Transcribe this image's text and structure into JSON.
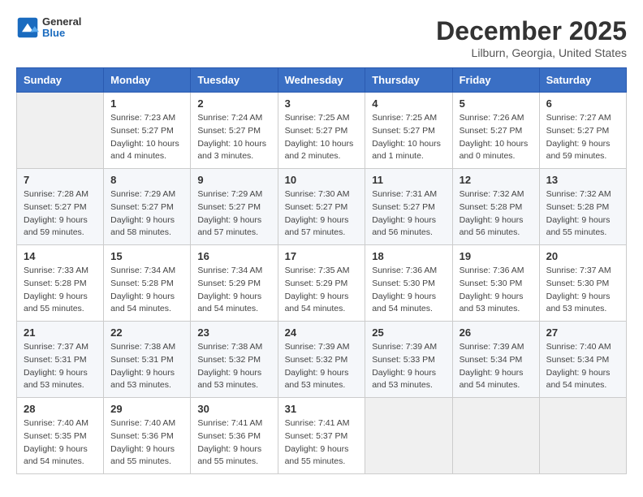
{
  "header": {
    "logo_general": "General",
    "logo_blue": "Blue",
    "month_title": "December 2025",
    "location": "Lilburn, Georgia, United States"
  },
  "weekdays": [
    "Sunday",
    "Monday",
    "Tuesday",
    "Wednesday",
    "Thursday",
    "Friday",
    "Saturday"
  ],
  "weeks": [
    [
      {
        "day": "",
        "info": ""
      },
      {
        "day": "1",
        "info": "Sunrise: 7:23 AM\nSunset: 5:27 PM\nDaylight: 10 hours\nand 4 minutes."
      },
      {
        "day": "2",
        "info": "Sunrise: 7:24 AM\nSunset: 5:27 PM\nDaylight: 10 hours\nand 3 minutes."
      },
      {
        "day": "3",
        "info": "Sunrise: 7:25 AM\nSunset: 5:27 PM\nDaylight: 10 hours\nand 2 minutes."
      },
      {
        "day": "4",
        "info": "Sunrise: 7:25 AM\nSunset: 5:27 PM\nDaylight: 10 hours\nand 1 minute."
      },
      {
        "day": "5",
        "info": "Sunrise: 7:26 AM\nSunset: 5:27 PM\nDaylight: 10 hours\nand 0 minutes."
      },
      {
        "day": "6",
        "info": "Sunrise: 7:27 AM\nSunset: 5:27 PM\nDaylight: 9 hours\nand 59 minutes."
      }
    ],
    [
      {
        "day": "7",
        "info": "Sunrise: 7:28 AM\nSunset: 5:27 PM\nDaylight: 9 hours\nand 59 minutes."
      },
      {
        "day": "8",
        "info": "Sunrise: 7:29 AM\nSunset: 5:27 PM\nDaylight: 9 hours\nand 58 minutes."
      },
      {
        "day": "9",
        "info": "Sunrise: 7:29 AM\nSunset: 5:27 PM\nDaylight: 9 hours\nand 57 minutes."
      },
      {
        "day": "10",
        "info": "Sunrise: 7:30 AM\nSunset: 5:27 PM\nDaylight: 9 hours\nand 57 minutes."
      },
      {
        "day": "11",
        "info": "Sunrise: 7:31 AM\nSunset: 5:27 PM\nDaylight: 9 hours\nand 56 minutes."
      },
      {
        "day": "12",
        "info": "Sunrise: 7:32 AM\nSunset: 5:28 PM\nDaylight: 9 hours\nand 56 minutes."
      },
      {
        "day": "13",
        "info": "Sunrise: 7:32 AM\nSunset: 5:28 PM\nDaylight: 9 hours\nand 55 minutes."
      }
    ],
    [
      {
        "day": "14",
        "info": "Sunrise: 7:33 AM\nSunset: 5:28 PM\nDaylight: 9 hours\nand 55 minutes."
      },
      {
        "day": "15",
        "info": "Sunrise: 7:34 AM\nSunset: 5:28 PM\nDaylight: 9 hours\nand 54 minutes."
      },
      {
        "day": "16",
        "info": "Sunrise: 7:34 AM\nSunset: 5:29 PM\nDaylight: 9 hours\nand 54 minutes."
      },
      {
        "day": "17",
        "info": "Sunrise: 7:35 AM\nSunset: 5:29 PM\nDaylight: 9 hours\nand 54 minutes."
      },
      {
        "day": "18",
        "info": "Sunrise: 7:36 AM\nSunset: 5:30 PM\nDaylight: 9 hours\nand 54 minutes."
      },
      {
        "day": "19",
        "info": "Sunrise: 7:36 AM\nSunset: 5:30 PM\nDaylight: 9 hours\nand 53 minutes."
      },
      {
        "day": "20",
        "info": "Sunrise: 7:37 AM\nSunset: 5:30 PM\nDaylight: 9 hours\nand 53 minutes."
      }
    ],
    [
      {
        "day": "21",
        "info": "Sunrise: 7:37 AM\nSunset: 5:31 PM\nDaylight: 9 hours\nand 53 minutes."
      },
      {
        "day": "22",
        "info": "Sunrise: 7:38 AM\nSunset: 5:31 PM\nDaylight: 9 hours\nand 53 minutes."
      },
      {
        "day": "23",
        "info": "Sunrise: 7:38 AM\nSunset: 5:32 PM\nDaylight: 9 hours\nand 53 minutes."
      },
      {
        "day": "24",
        "info": "Sunrise: 7:39 AM\nSunset: 5:32 PM\nDaylight: 9 hours\nand 53 minutes."
      },
      {
        "day": "25",
        "info": "Sunrise: 7:39 AM\nSunset: 5:33 PM\nDaylight: 9 hours\nand 53 minutes."
      },
      {
        "day": "26",
        "info": "Sunrise: 7:39 AM\nSunset: 5:34 PM\nDaylight: 9 hours\nand 54 minutes."
      },
      {
        "day": "27",
        "info": "Sunrise: 7:40 AM\nSunset: 5:34 PM\nDaylight: 9 hours\nand 54 minutes."
      }
    ],
    [
      {
        "day": "28",
        "info": "Sunrise: 7:40 AM\nSunset: 5:35 PM\nDaylight: 9 hours\nand 54 minutes."
      },
      {
        "day": "29",
        "info": "Sunrise: 7:40 AM\nSunset: 5:36 PM\nDaylight: 9 hours\nand 55 minutes."
      },
      {
        "day": "30",
        "info": "Sunrise: 7:41 AM\nSunset: 5:36 PM\nDaylight: 9 hours\nand 55 minutes."
      },
      {
        "day": "31",
        "info": "Sunrise: 7:41 AM\nSunset: 5:37 PM\nDaylight: 9 hours\nand 55 minutes."
      },
      {
        "day": "",
        "info": ""
      },
      {
        "day": "",
        "info": ""
      },
      {
        "day": "",
        "info": ""
      }
    ]
  ]
}
